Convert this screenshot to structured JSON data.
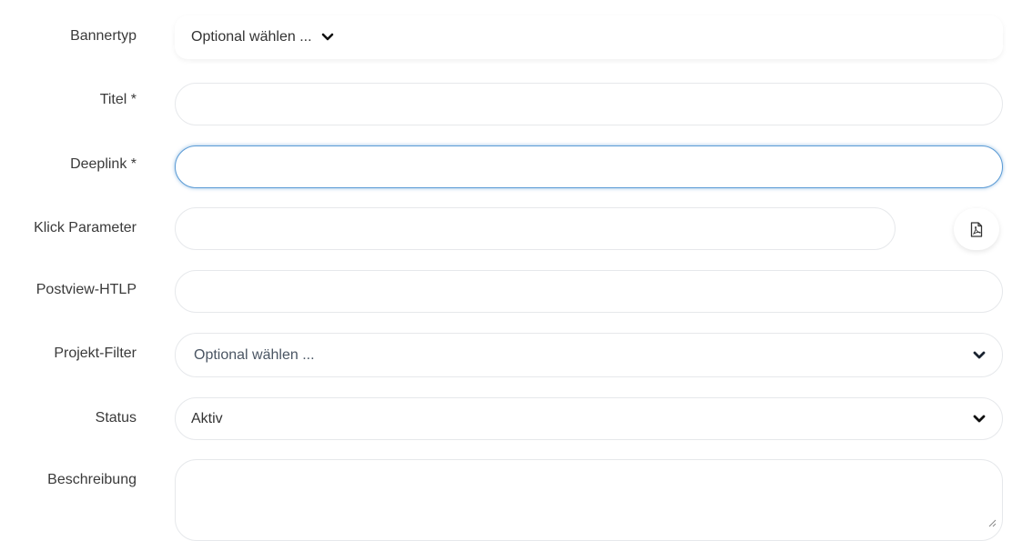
{
  "form": {
    "bannertyp": {
      "label": "Bannertyp",
      "value": "Optional wählen ..."
    },
    "titel": {
      "label": "Titel *",
      "value": ""
    },
    "deeplink": {
      "label": "Deeplink *",
      "value": ""
    },
    "klick_parameter": {
      "label": "Klick Parameter",
      "value": ""
    },
    "postview": {
      "label": "Postview-HTLP",
      "value": ""
    },
    "projekt_filter": {
      "label": "Projekt-Filter",
      "value": "Optional wählen ..."
    },
    "status": {
      "label": "Status",
      "value": "Aktiv"
    },
    "beschreibung": {
      "label": "Beschreibung",
      "value": ""
    }
  },
  "icons": {
    "dropdown": "chevron-down-icon",
    "pdf": "pdf-file-icon",
    "resize": "resize-handle-icon"
  },
  "colors": {
    "focus": "#5b9bd5",
    "border": "#e6e8eb"
  }
}
